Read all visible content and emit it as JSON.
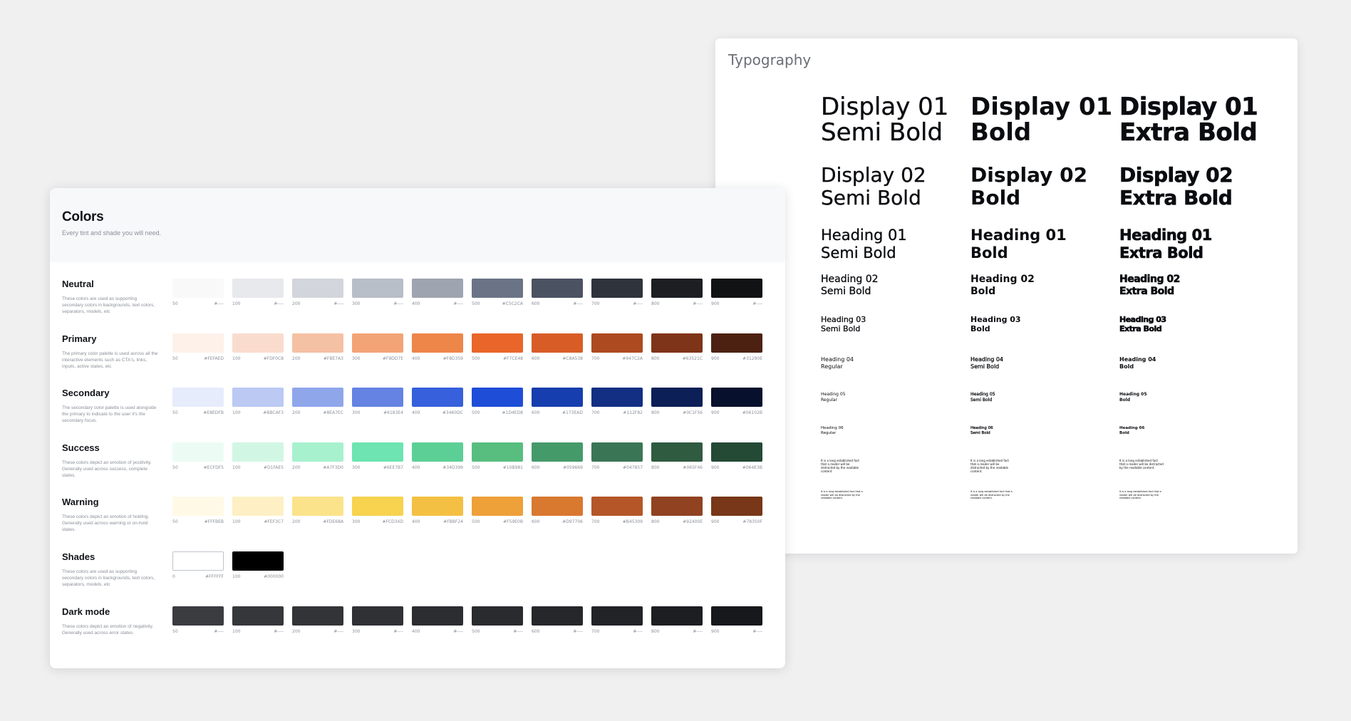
{
  "typography": {
    "title": "Typography",
    "cells": [
      [
        "Display 01\nSemi Bold",
        "Display 01\nBold",
        "Display 01\nExtra Bold"
      ],
      [
        "Display 02\nSemi Bold",
        "Display 02\nBold",
        "Display 02\nExtra Bold"
      ],
      [
        "Heading 01\nSemi Bold",
        "Heading 01\nBold",
        "Heading 01\nExtra Bold"
      ],
      [
        "Heading 02\nSemi Bold",
        "Heading 02\nBold",
        "Heading 02\nExtra Bold"
      ],
      [
        "Heading 03\nSemi Bold",
        "Heading 03\nBold",
        "Heading 03\nExtra Bold"
      ],
      [
        "Heading 04\nRegular",
        "Heading 04\nSemi Bold",
        "Heading 04\nBold"
      ],
      [
        "Heading 05\nRegular",
        "Heading 05\nSemi Bold",
        "Heading 05\nBold"
      ],
      [
        "Heading 06\nRegular",
        "Heading 06\nSemi Bold",
        "Heading 06\nBold"
      ],
      [
        "It is a long established fact\nthat a reader will be\ndistracted by the readable\ncontent.",
        "It is a long established fact\nthat a reader will be\ndistracted by the readable\ncontent.",
        "It is a long established fact\nthat a reader will be distracted\nby the readable content."
      ],
      [
        "It is a long established fact that a\nreader will be distracted by the\nreadable content.",
        "It is a long established fact that a\nreader will be distracted by the\nreadable content.",
        "It is a long established fact that a\nreader will be distracted by the\nreadable content."
      ]
    ]
  },
  "colors": {
    "title": "Colors",
    "subtitle": "Every tint and shade you will need.",
    "rows": [
      {
        "name": "Neutral",
        "desc": "These colors are used as supporting secondary colors in backgrounds, text colors, separators, models, etc",
        "swatches": [
          {
            "step": "50",
            "hex": "#----",
            "color": "#f9f9fa"
          },
          {
            "step": "100",
            "hex": "#----",
            "color": "#e8e9ec"
          },
          {
            "step": "200",
            "hex": "#----",
            "color": "#d2d5db"
          },
          {
            "step": "300",
            "hex": "#----",
            "color": "#b8bec8"
          },
          {
            "step": "400",
            "hex": "#----",
            "color": "#9ea4b0"
          },
          {
            "step": "500",
            "hex": "#C5C2CA",
            "color": "#6b7487"
          },
          {
            "step": "600",
            "hex": "#----",
            "color": "#4b5262"
          },
          {
            "step": "700",
            "hex": "#----",
            "color": "#2e333c"
          },
          {
            "step": "800",
            "hex": "#----",
            "color": "#1c1e22"
          },
          {
            "step": "900",
            "hex": "#----",
            "color": "#111214"
          }
        ]
      },
      {
        "name": "Primary",
        "desc": "The primary color palette is used across all the interactive elements such as CTA's, links, inputs, active states, etc",
        "swatches": [
          {
            "step": "50",
            "hex": "#FEFAED",
            "color": "#fdf1ea"
          },
          {
            "step": "100",
            "hex": "#FDF0C8",
            "color": "#fadccf"
          },
          {
            "step": "200",
            "hex": "#FBE7A3",
            "color": "#f5c1a4"
          },
          {
            "step": "300",
            "hex": "#F9DD7E",
            "color": "#f2a477"
          },
          {
            "step": "400",
            "hex": "#F8D359",
            "color": "#ee8549"
          },
          {
            "step": "500",
            "hex": "#F7CE48",
            "color": "#e9652a"
          },
          {
            "step": "600",
            "hex": "#C8A538",
            "color": "#d85c26"
          },
          {
            "step": "700",
            "hex": "#947C2A",
            "color": "#ad4a1f"
          },
          {
            "step": "800",
            "hex": "#63521C",
            "color": "#7e3418"
          },
          {
            "step": "900",
            "hex": "#31290E",
            "color": "#4d2111"
          }
        ]
      },
      {
        "name": "Secondary",
        "desc": "The secondary color palette is used alongside the primary to indicate to the user it's the secondary focus.",
        "swatches": [
          {
            "step": "50",
            "hex": "#E8EDFB",
            "color": "#e6ecfb"
          },
          {
            "step": "100",
            "hex": "#BBCAF3",
            "color": "#bbc9f3"
          },
          {
            "step": "200",
            "hex": "#8EA7EC",
            "color": "#8fa6eb"
          },
          {
            "step": "300",
            "hex": "#6183E4",
            "color": "#6483e2"
          },
          {
            "step": "400",
            "hex": "#3460DC",
            "color": "#3660dc"
          },
          {
            "step": "500",
            "hex": "#1D4ED8",
            "color": "#1e4ed8"
          },
          {
            "step": "600",
            "hex": "#173EAD",
            "color": "#173eae"
          },
          {
            "step": "700",
            "hex": "#112F82",
            "color": "#122f83"
          },
          {
            "step": "800",
            "hex": "#0C1F56",
            "color": "#0c1f56"
          },
          {
            "step": "900",
            "hex": "#06102B",
            "color": "#07102c"
          }
        ]
      },
      {
        "name": "Success",
        "desc": "These colors depict an emotion of positivity. Generally used across success, complete states.",
        "swatches": [
          {
            "step": "50",
            "hex": "#ECFDF5",
            "color": "#ecfcf4"
          },
          {
            "step": "100",
            "hex": "#D1FAE5",
            "color": "#d1f7e4"
          },
          {
            "step": "200",
            "hex": "#A7F3D0",
            "color": "#a7f1cf"
          },
          {
            "step": "300",
            "hex": "#6EE7B7",
            "color": "#6de4b2"
          },
          {
            "step": "400",
            "hex": "#34D399",
            "color": "#5ccf96"
          },
          {
            "step": "500",
            "hex": "#10B981",
            "color": "#58be80"
          },
          {
            "step": "600",
            "hex": "#059669",
            "color": "#459a6a"
          },
          {
            "step": "700",
            "hex": "#047857",
            "color": "#3a7655"
          },
          {
            "step": "800",
            "hex": "#065F46",
            "color": "#2f5b41"
          },
          {
            "step": "900",
            "hex": "#064E3B",
            "color": "#244a36"
          }
        ]
      },
      {
        "name": "Warning",
        "desc": "These colors depict an emotion of holding. Generally used across warning or on-hold states.",
        "swatches": [
          {
            "step": "50",
            "hex": "#FFFBEB",
            "color": "#fff9e6"
          },
          {
            "step": "100",
            "hex": "#FEF3C7",
            "color": "#fef0c4"
          },
          {
            "step": "200",
            "hex": "#FDE68A",
            "color": "#fbe38b"
          },
          {
            "step": "300",
            "hex": "#FCD34D",
            "color": "#f7d34f"
          },
          {
            "step": "400",
            "hex": "#FBBF24",
            "color": "#f4c043"
          },
          {
            "step": "500",
            "hex": "#F59E0B",
            "color": "#eea039"
          },
          {
            "step": "600",
            "hex": "#D97706",
            "color": "#d9782f"
          },
          {
            "step": "700",
            "hex": "#B45309",
            "color": "#b45627"
          },
          {
            "step": "800",
            "hex": "#92400E",
            "color": "#904221"
          },
          {
            "step": "900",
            "hex": "#78350F",
            "color": "#773718"
          }
        ]
      },
      {
        "name": "Shades",
        "desc": "These colors are used as supporting secondary colors in backgrounds, text colors, separators, models, etc",
        "swatches": [
          {
            "step": "0",
            "hex": "#FFFFFF",
            "color": "#ffffff"
          },
          {
            "step": "100",
            "hex": "#000000",
            "color": "#000000"
          }
        ]
      },
      {
        "name": "Dark mode",
        "desc": "These colors depict an emotion of negativity. Generally used across error states.",
        "swatches": [
          {
            "step": "50",
            "hex": "#----",
            "color": "#3b3c40"
          },
          {
            "step": "100",
            "hex": "#----",
            "color": "#36373b"
          },
          {
            "step": "200",
            "hex": "#----",
            "color": "#333438"
          },
          {
            "step": "300",
            "hex": "#----",
            "color": "#303135"
          },
          {
            "step": "400",
            "hex": "#----",
            "color": "#2c2d31"
          },
          {
            "step": "500",
            "hex": "#----",
            "color": "#2a2b2f"
          },
          {
            "step": "600",
            "hex": "#----",
            "color": "#26272b"
          },
          {
            "step": "700",
            "hex": "#----",
            "color": "#222327"
          },
          {
            "step": "800",
            "hex": "#----",
            "color": "#1d1e22"
          },
          {
            "step": "900",
            "hex": "#----",
            "color": "#17181c"
          }
        ]
      }
    ]
  }
}
